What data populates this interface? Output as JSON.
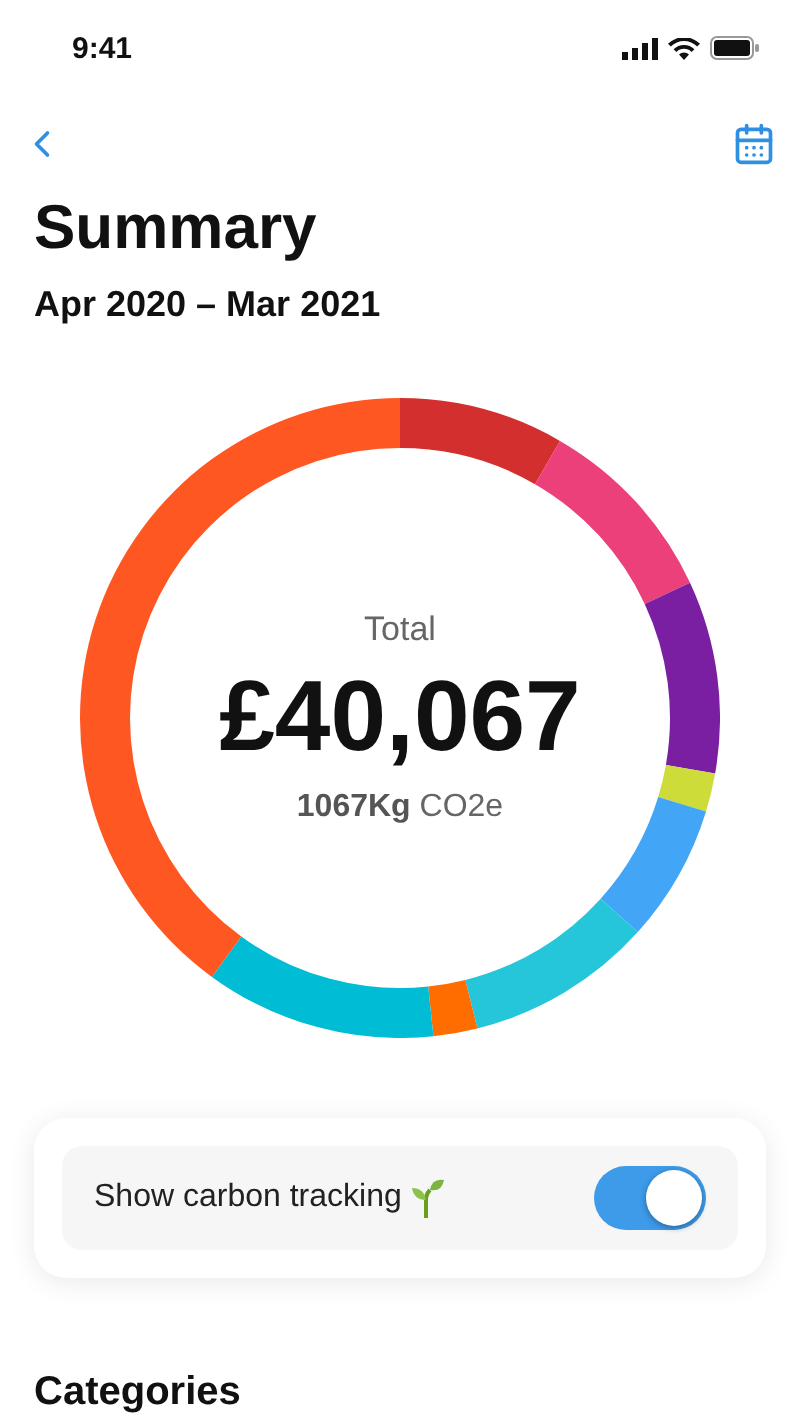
{
  "status_bar": {
    "time": "9:41"
  },
  "header": {
    "title": "Summary",
    "period": "Apr 2020 – Mar 2021"
  },
  "total": {
    "label": "Total",
    "amount": "£40,067",
    "carbon": "**1067Kg** CO2e"
  },
  "carbon_toggle": {
    "label": "Show carbon tracking",
    "on": true
  },
  "section_title": "Categories"
}
